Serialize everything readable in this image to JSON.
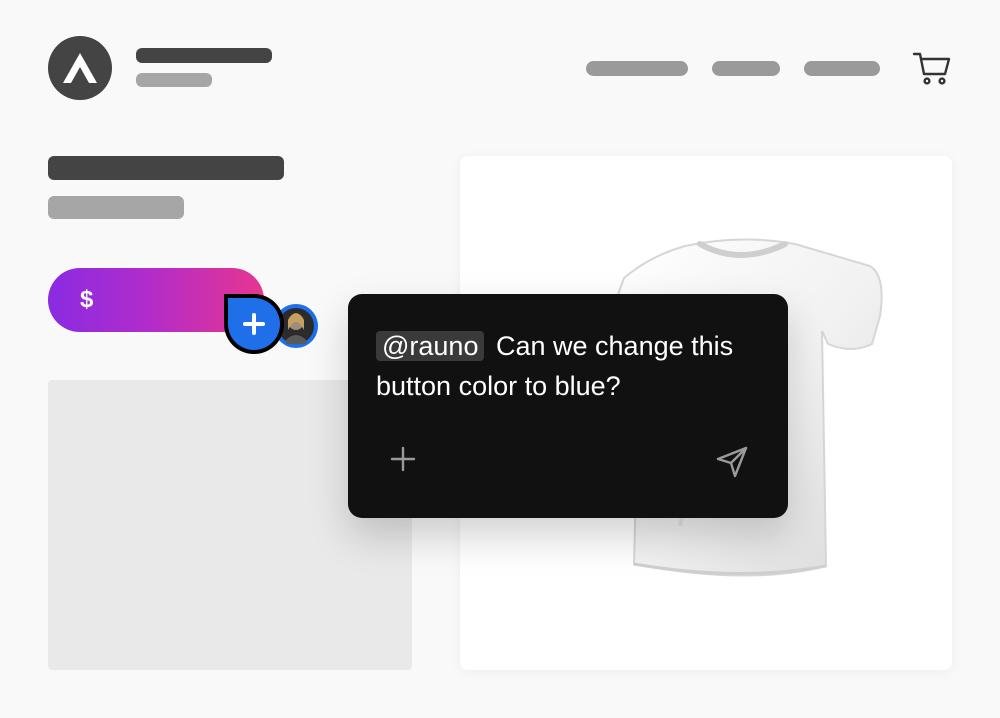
{
  "header": {
    "logo_icon": "triangle-logo-icon",
    "cart_icon": "shopping-cart-icon"
  },
  "price_button": {
    "label": "$"
  },
  "comment": {
    "mention": "@rauno",
    "message": "Can we change this button color to blue?",
    "add_icon": "plus-icon",
    "send_icon": "send-icon",
    "pin_icon": "plus-icon"
  },
  "colors": {
    "gradient_start": "#8a2be2",
    "gradient_end": "#e8358f",
    "pin_blue": "#1e6fe8",
    "popup_bg": "#111111"
  }
}
